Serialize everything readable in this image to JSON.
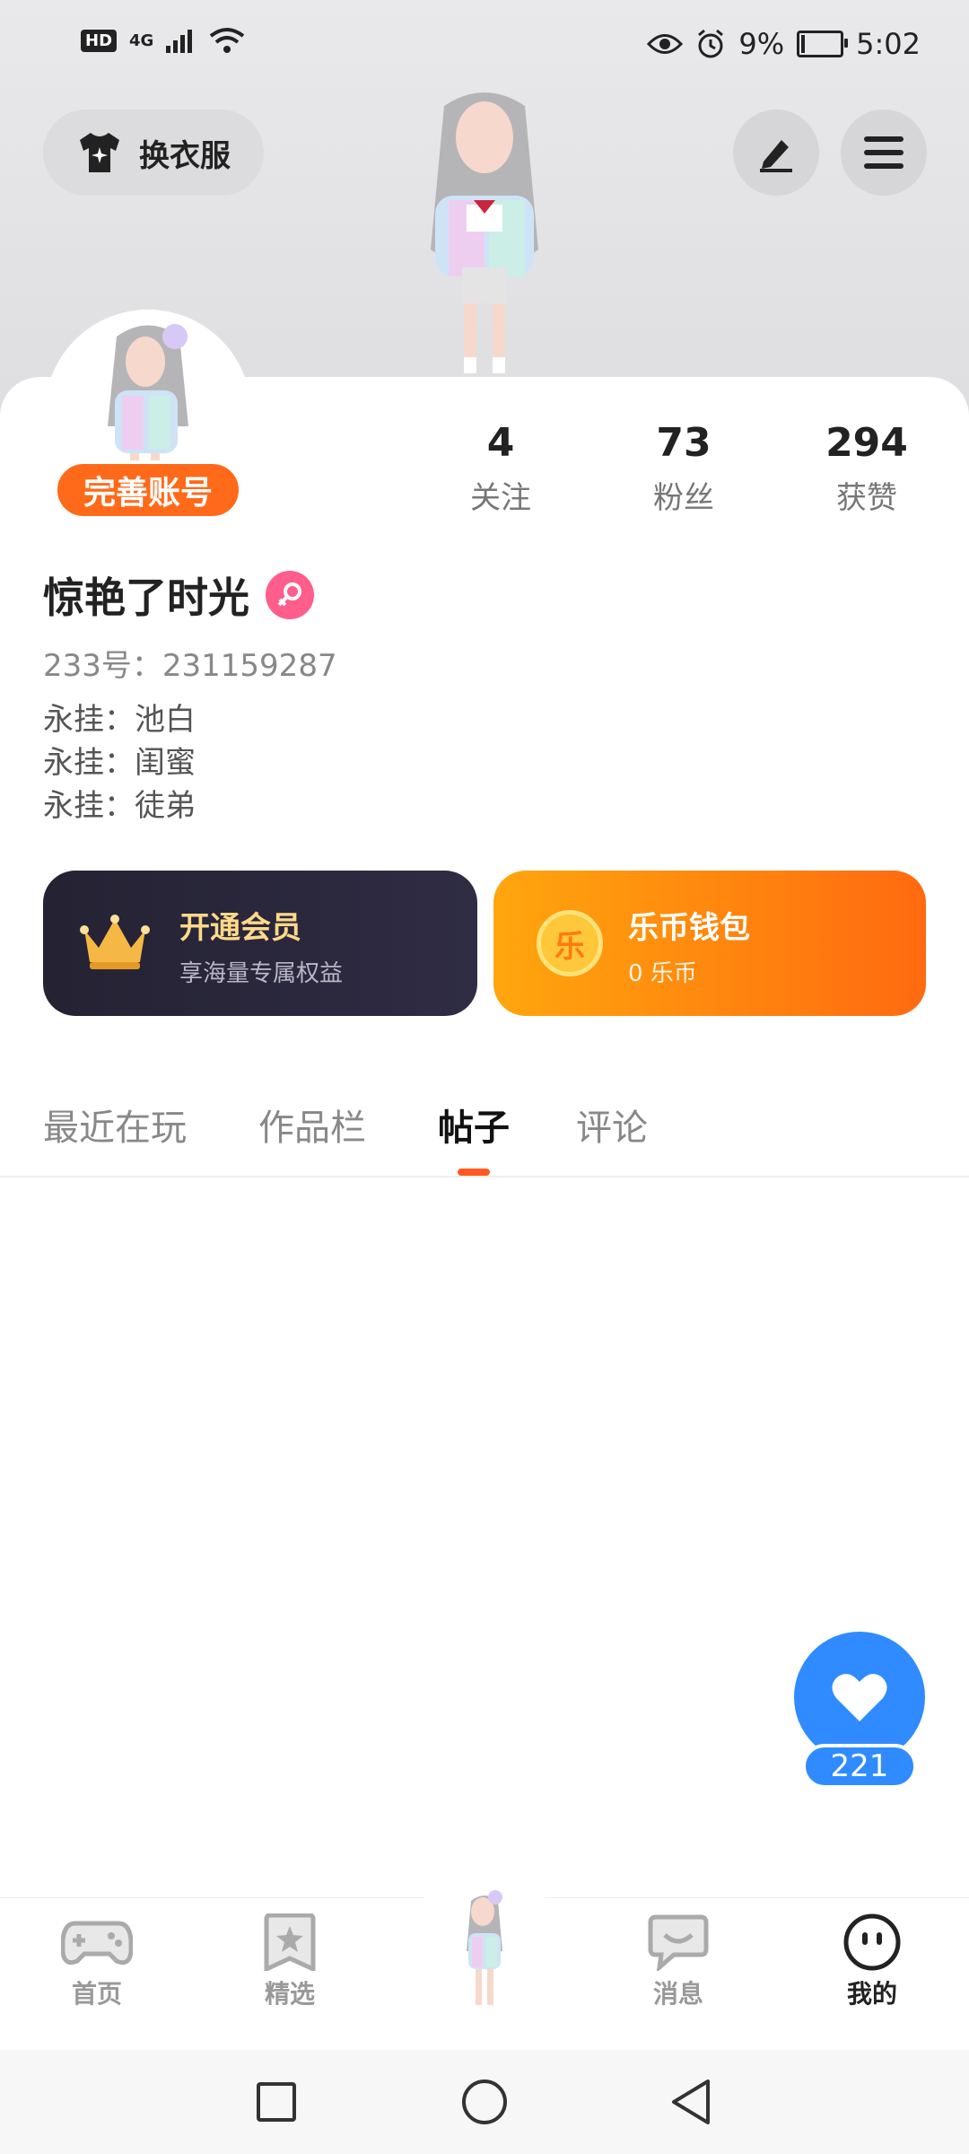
{
  "status_bar": {
    "hd": "HD",
    "network": "4G",
    "battery_percent": "9%",
    "battery_level": 0.09,
    "time": "5:02"
  },
  "header": {
    "outfit_label": "换衣服",
    "edit_icon": "pen-icon",
    "menu_icon": "hamburger-icon"
  },
  "profile": {
    "complete_account_label": "完善账号",
    "stats": [
      {
        "value": "4",
        "label": "关注"
      },
      {
        "value": "73",
        "label": "粉丝"
      },
      {
        "value": "294",
        "label": "获赞"
      }
    ],
    "username": "惊艳了时光",
    "gender": "female",
    "uid_text": "233号：231159287",
    "pins": [
      "永挂：池白",
      "永挂：闺蜜",
      "永挂：徒弟"
    ]
  },
  "vip_card": {
    "title": "开通会员",
    "subtitle": "享海量专属权益",
    "title_color": "#ffd98a"
  },
  "wallet_card": {
    "title": "乐币钱包",
    "subtitle": "0 乐币",
    "coin_glyph": "乐"
  },
  "tabs": [
    {
      "label": "最近在玩",
      "active": false
    },
    {
      "label": "作品栏",
      "active": false
    },
    {
      "label": "帖子",
      "active": true
    },
    {
      "label": "评论",
      "active": false
    }
  ],
  "like_button": {
    "count": "221"
  },
  "bottom_nav": [
    {
      "label": "首页",
      "icon": "gamepad-icon"
    },
    {
      "label": "精选",
      "icon": "star-bookmark-icon"
    },
    {
      "label": "",
      "icon": "character-avatar"
    },
    {
      "label": "消息",
      "icon": "chat-smile-icon"
    },
    {
      "label": "我的",
      "icon": "face-icon",
      "active": true
    }
  ],
  "colors": {
    "accent": "#ff6a1a",
    "like_blue": "#2f8bff",
    "vip_dark": "#252233",
    "wallet_orange": "#ff8a10"
  }
}
